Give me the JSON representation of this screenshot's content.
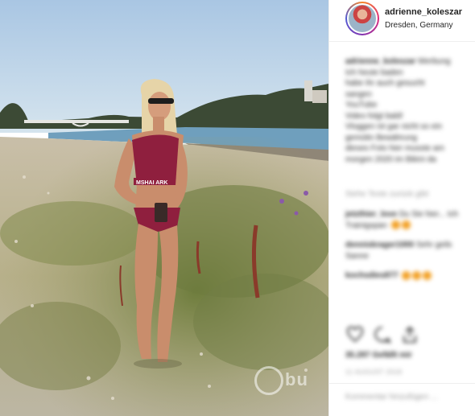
{
  "post": {
    "username": "adrienne_koleszar",
    "location": "Dresden, Germany"
  },
  "image": {
    "description_name": "beach-river-photo",
    "watermark_text": "bu"
  },
  "caption": {
    "author": "adrienne_koleszar",
    "text_lines": [
      "Werbung",
      "Ich heute baden",
      "habe ihr auch gesucht",
      "sangen",
      "YouTube",
      "Video folgt bald!",
      "Vloggen ist gar nicht so ein",
      "gemütin Bewährung",
      "dieses Foto hier musste am",
      "morgen 2020 im Bikini da"
    ],
    "see_translation": "Siehe Texte zurück gibt"
  },
  "comments": [
    {
      "user": "jetzthier_love",
      "text": "Du Sie hier... Ich Trainigspan"
    },
    {
      "user": "denniskrager1000",
      "text": "Sehr geils Sanne"
    },
    {
      "user": "kochsdies877",
      "text": ""
    }
  ],
  "actions": {
    "like_icon": "heart-icon",
    "comment_icon": "comment-icon",
    "share_icon": "share-icon"
  },
  "stats": {
    "likes": "35.287 Gefällt mir",
    "date": "11 AUGUST 2018"
  },
  "add_comment_placeholder": "Kommentar hinzufügen ..."
}
